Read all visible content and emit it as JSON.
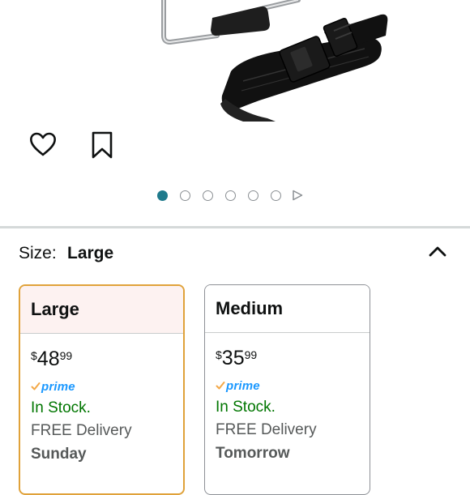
{
  "size": {
    "label": "Size:",
    "value": "Large"
  },
  "carousel": {
    "count": 6,
    "active_index": 0
  },
  "colors": {
    "accent_teal": "#1f7a8c",
    "selected_border": "#e0a23a",
    "in_stock_green": "#007600",
    "prime_blue": "#1a98ff"
  },
  "options": [
    {
      "title": "Large",
      "currency": "$",
      "price_whole": "48",
      "price_fraction": "99",
      "prime": "prime",
      "stock": "In Stock.",
      "delivery": "FREE Delivery",
      "delivery_day": "Sunday"
    },
    {
      "title": "Medium",
      "currency": "$",
      "price_whole": "35",
      "price_fraction": "99",
      "prime": "prime",
      "stock": "In Stock.",
      "delivery": "FREE Delivery",
      "delivery_day": "Tomorrow"
    }
  ]
}
